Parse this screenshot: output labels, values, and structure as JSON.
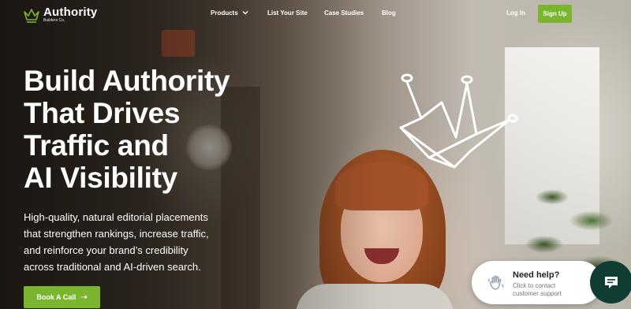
{
  "nav": {
    "logo_title": "Authority",
    "logo_subtitle": "Builders Co.",
    "items": [
      {
        "label": "Products"
      },
      {
        "label": "List Your Site"
      },
      {
        "label": "Case Studies"
      },
      {
        "label": "Blog"
      }
    ],
    "login_label": "Log In",
    "signup_label": "Sign Up"
  },
  "hero": {
    "headline_lines": [
      "Build Authority",
      "That Drives",
      "Traffic and",
      "AI Visibility"
    ],
    "subtext_lines": [
      "High-quality, natural editorial placements",
      "that strengthen rankings, increase traffic,",
      "and reinforce your brand’s credibility",
      "across traditional and AI-driven search."
    ],
    "cta_label": "Book A Call",
    "cta_icon": "arrow-right-icon"
  },
  "help_widget": {
    "title": "Need help?",
    "subtitle_lines": [
      "Click to contact",
      "customer support"
    ],
    "icon": "waving-hand-icon",
    "chat_icon": "chat-bubble-icon"
  },
  "colors": {
    "accent": "#7ab52e",
    "chat_button": "#0f3d33"
  }
}
